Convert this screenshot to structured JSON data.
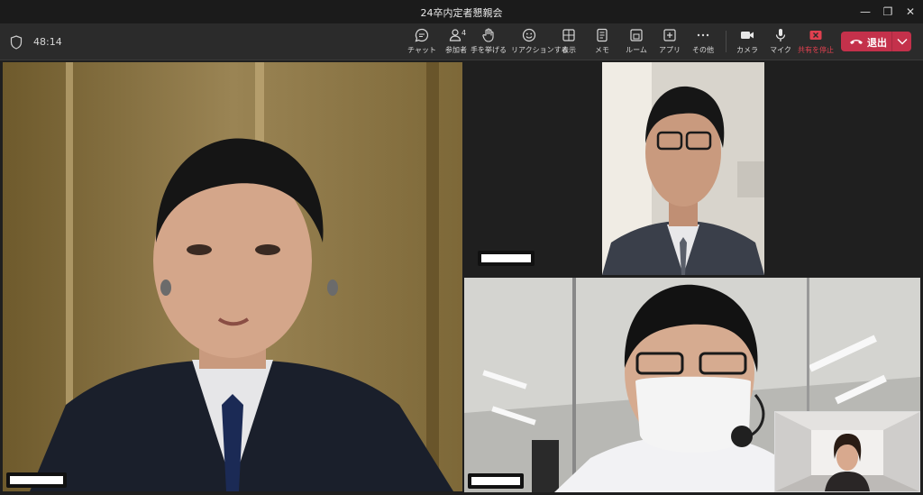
{
  "window": {
    "title": "24卒内定者懇親会"
  },
  "meeting": {
    "timer": "48:14"
  },
  "toolbar": {
    "chat": "チャット",
    "participants": "参加者",
    "participants_count": "4",
    "raise_hand": "手を挙げる",
    "react": "リアクションする",
    "view": "表示",
    "notes": "メモ",
    "rooms": "ルーム",
    "apps": "アプリ",
    "more": "その他",
    "camera": "カメラ",
    "mic": "マイク",
    "stop_share": "共有を停止",
    "leave": "退出"
  },
  "icons": {
    "shield": "shield-icon",
    "chat": "chat-icon",
    "participants": "people-icon",
    "raise_hand": "hand-icon",
    "react": "smiley-icon",
    "view": "grid-icon",
    "notes": "notes-icon",
    "rooms": "rooms-icon",
    "apps": "apps-icon",
    "more": "more-icon",
    "camera": "camera-icon",
    "mic": "mic-icon",
    "stop_share": "stop-share-icon",
    "leave": "phone-hangup-icon"
  },
  "colors": {
    "leave": "#c4314b",
    "stop_share": "#e0404f",
    "toolbar": "#2b2b2b"
  }
}
